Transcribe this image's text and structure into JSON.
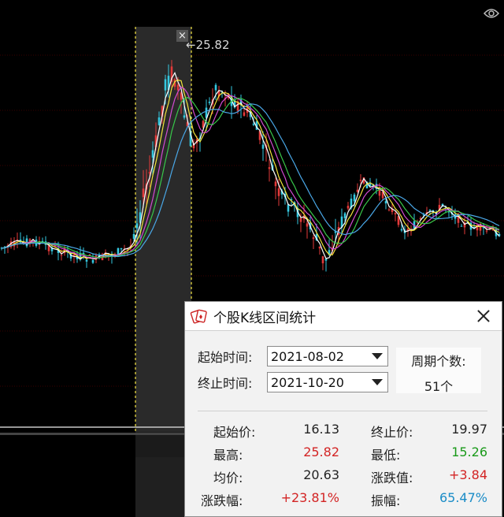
{
  "chart": {
    "high_price_label": "25.82",
    "close_marker": "×",
    "colors": {
      "up": "#e33a3a",
      "down": "#35c8e0",
      "ma5": "#ffffff",
      "ma10": "#f2e53a",
      "ma20": "#d24bd2",
      "ma30": "#38c84a",
      "ma60": "#4aa8e8",
      "selection": "#2a2a2a",
      "selection_border": "#f5e642"
    }
  },
  "dialog": {
    "title": "个股K线区间统计",
    "start_time_label": "起始时间:",
    "start_time_value": "2021-08-02",
    "end_time_label": "终止时间:",
    "end_time_value": "2021-10-20",
    "period_count_label": "周期个数:",
    "period_count_value": "51个",
    "stats": {
      "start_price_label": "起始价:",
      "start_price_value": "16.13",
      "end_price_label": "终止价:",
      "end_price_value": "19.97",
      "high_label": "最高:",
      "high_value": "25.82",
      "low_label": "最低:",
      "low_value": "15.26",
      "avg_label": "均价:",
      "avg_value": "20.63",
      "change_label": "涨跌值:",
      "change_value": "+3.84",
      "change_pct_label": "涨跌幅:",
      "change_pct_value": "+23.81%",
      "amplitude_label": "振幅:",
      "amplitude_value": "65.47%"
    }
  }
}
